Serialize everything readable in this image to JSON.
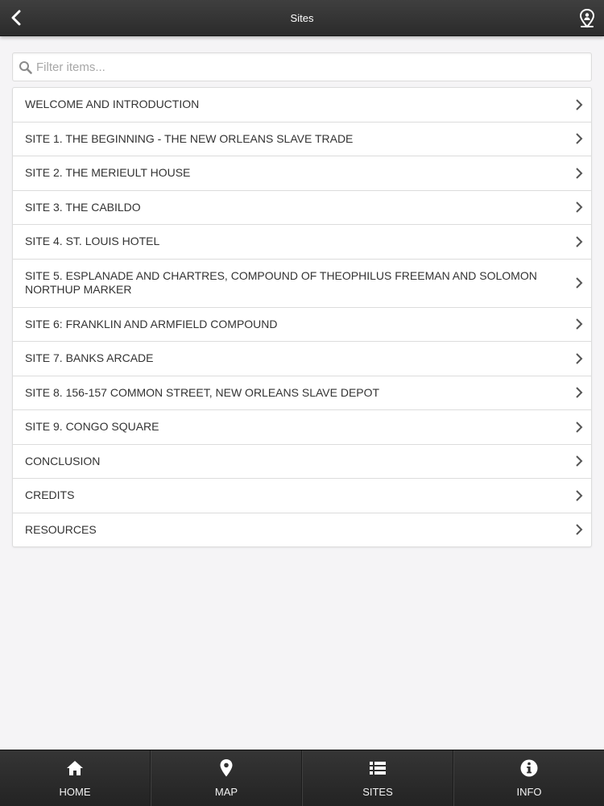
{
  "header": {
    "title": "Sites",
    "back_icon": "chevron-left-icon",
    "location_icon": "map-pin-person-icon"
  },
  "search": {
    "placeholder": "Filter items...",
    "value": "",
    "icon": "search-icon"
  },
  "sites": {
    "items": [
      {
        "label": "WELCOME AND INTRODUCTION"
      },
      {
        "label": "SITE 1. THE BEGINNING - THE NEW ORLEANS SLAVE TRADE"
      },
      {
        "label": "SITE 2. THE MERIEULT HOUSE"
      },
      {
        "label": "SITE 3. THE CABILDO"
      },
      {
        "label": "SITE 4. ST. LOUIS HOTEL"
      },
      {
        "label": "SITE 5. ESPLANADE AND CHARTRES, COMPOUND OF THEOPHILUS FREEMAN AND SOLOMON NORTHUP MARKER"
      },
      {
        "label": "SITE 6: FRANKLIN AND ARMFIELD COMPOUND"
      },
      {
        "label": "SITE 7. BANKS ARCADE"
      },
      {
        "label": "SITE 8. 156-157 COMMON STREET, NEW ORLEANS SLAVE DEPOT"
      },
      {
        "label": "SITE 9. CONGO SQUARE"
      },
      {
        "label": "CONCLUSION"
      },
      {
        "label": "CREDITS"
      },
      {
        "label": "RESOURCES"
      }
    ]
  },
  "tabbar": {
    "tabs": [
      {
        "label": "HOME",
        "icon": "home-icon"
      },
      {
        "label": "MAP",
        "icon": "map-pin-icon"
      },
      {
        "label": "SITES",
        "icon": "list-icon"
      },
      {
        "label": "INFO",
        "icon": "info-icon"
      }
    ]
  },
  "colors": {
    "bar_background": "#2f2f2f",
    "page_background": "#f5f4f6",
    "list_border": "#dcdcdc",
    "text": "#333333"
  }
}
